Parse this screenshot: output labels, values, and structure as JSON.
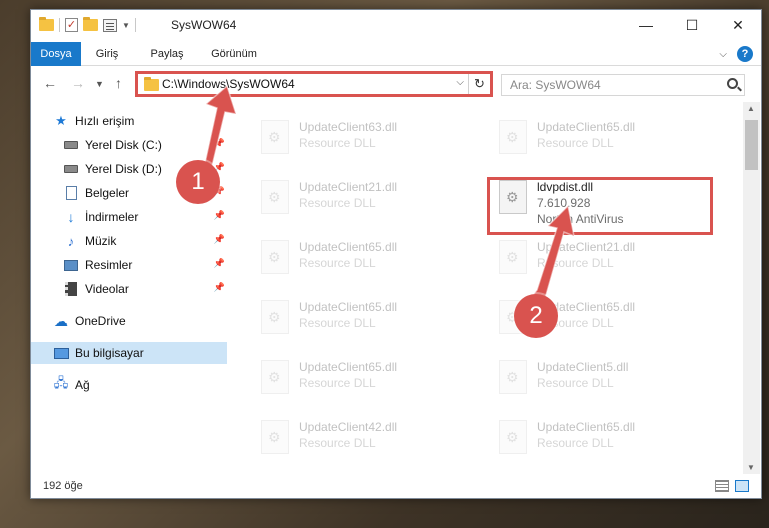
{
  "window": {
    "title": "SysWOW64"
  },
  "ribbon": {
    "tabs": [
      "Dosya",
      "Giriş",
      "Paylaş",
      "Görünüm"
    ]
  },
  "nav": {
    "address": "C:\\Windows\\SysWOW64",
    "search_placeholder": "Ara: SysWOW64"
  },
  "sidebar": {
    "items": [
      {
        "label": "Hızlı erişim",
        "icon": "star-icon"
      },
      {
        "label": "Yerel Disk (C:)",
        "icon": "drive-icon"
      },
      {
        "label": "Yerel Disk (D:)",
        "icon": "drive-icon"
      },
      {
        "label": "Belgeler",
        "icon": "document-icon"
      },
      {
        "label": "İndirmeler",
        "icon": "download-icon"
      },
      {
        "label": "Müzik",
        "icon": "music-icon"
      },
      {
        "label": "Resimler",
        "icon": "pictures-icon"
      },
      {
        "label": "Videolar",
        "icon": "videos-icon"
      },
      {
        "label": "OneDrive",
        "icon": "cloud-icon"
      },
      {
        "label": "Bu bilgisayar",
        "icon": "computer-icon"
      },
      {
        "label": "Ağ",
        "icon": "network-icon"
      }
    ]
  },
  "files": [
    {
      "name": "UpdateClient63.dll",
      "type": "Resource DLL"
    },
    {
      "name": "UpdateClient65.dll",
      "type": "Resource DLL"
    },
    {
      "name": "UpdateClient21.dll",
      "type": "Resource DLL"
    },
    {
      "name": "ldvpdist.dll",
      "version": "7.610.928",
      "company": "Norton AntiVirus"
    },
    {
      "name": "UpdateClient65.dll",
      "type": "Resource DLL"
    },
    {
      "name": "UpdateClient21.dll",
      "type": "Resource DLL"
    },
    {
      "name": "UpdateClient65.dll",
      "type": "Resource DLL"
    },
    {
      "name": "UpdateClient65.dll",
      "type": "Resource DLL"
    },
    {
      "name": "UpdateClient65.dll",
      "type": "Resource DLL"
    },
    {
      "name": "UpdateClient5.dll",
      "type": "Resource DLL"
    },
    {
      "name": "UpdateClient42.dll",
      "type": "Resource DLL"
    },
    {
      "name": "UpdateClient65.dll",
      "type": "Resource DLL"
    }
  ],
  "status": {
    "count": "192 öğe"
  },
  "annotations": {
    "step1": "1",
    "step2": "2"
  },
  "colors": {
    "accent": "#1979ca",
    "highlight": "#d9534f",
    "selected": "#cce4f7"
  }
}
